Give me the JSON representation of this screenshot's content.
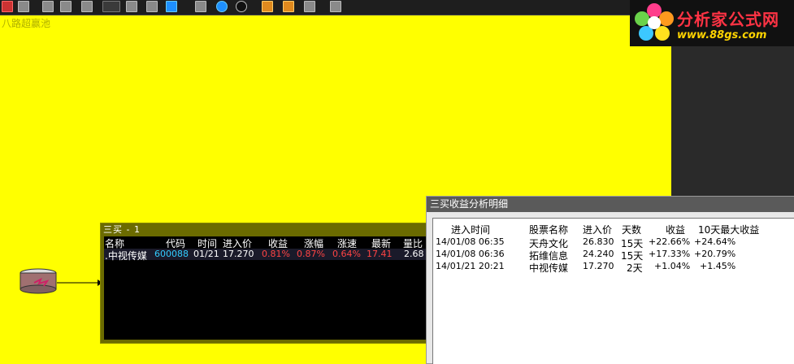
{
  "canvas": {
    "title": "八路超赢池"
  },
  "logo": {
    "name": "分析家公式网",
    "url": "www.88gs.com"
  },
  "buy_window": {
    "title": "三买 - 1",
    "headers": [
      "名称",
      "代码",
      "时间",
      "进入价",
      "收益",
      "涨幅",
      "涨速",
      "最新",
      "量比"
    ],
    "row": {
      "name": ".中视传媒",
      "code": "600088",
      "time": "01/21",
      "price": "17.270",
      "profit": "0.81%",
      "change": "0.87%",
      "speed": "0.64%",
      "latest": "17.41",
      "volume_ratio": "2.68"
    }
  },
  "detail_window": {
    "title": "三买收益分析明细",
    "headers": [
      "进入时间",
      "股票名称",
      "进入价",
      "天数",
      "收益",
      "10天最大收益"
    ],
    "rows": [
      [
        "14/01/08 06:35",
        "天舟文化",
        "26.830",
        "15天",
        "+22.66%",
        "+24.64%"
      ],
      [
        "14/01/08 06:36",
        "拓维信息",
        "24.240",
        "15天",
        "+17.33%",
        "+20.79%"
      ],
      [
        "14/01/21 20:21",
        "中视传媒",
        "17.270",
        "2天",
        "+1.04%",
        "+1.45%"
      ]
    ]
  },
  "colors": {
    "canvas_bg": "#ffff00",
    "code_cyan": "#33ccff",
    "rise_red": "#ff4444"
  }
}
